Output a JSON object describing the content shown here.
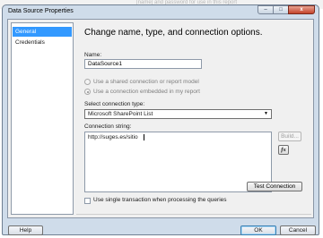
{
  "background_text": "[name] and password for use in this report",
  "window": {
    "title": "Data Source Properties",
    "caption_buttons": {
      "minimize": "–",
      "maximize": "□",
      "close": "x"
    }
  },
  "nav": {
    "items": [
      {
        "label": "General",
        "selected": true
      },
      {
        "label": "Credentials",
        "selected": false
      }
    ]
  },
  "panel": {
    "heading": "Change name, type, and connection options.",
    "name_label": "Name:",
    "name_value": "DataSource1",
    "radio_shared": "Use a shared connection or report model",
    "radio_embedded": "Use a connection embedded in my report",
    "connection_type_label": "Select connection type:",
    "connection_type_value": "Microsoft SharePoint List",
    "connection_string_label": "Connection string:",
    "connection_string_value": "http://suges.es/sitio",
    "build_button": "Build...",
    "expression_button": "fx",
    "test_connection_button": "Test Connection",
    "single_transaction_label": "Use single transaction when processing the queries"
  },
  "footer": {
    "help": "Help",
    "ok": "OK",
    "cancel": "Cancel"
  }
}
